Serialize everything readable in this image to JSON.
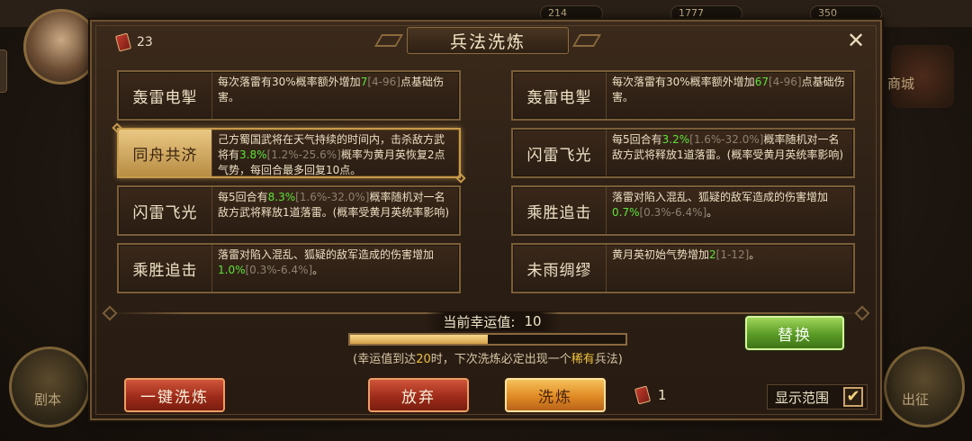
{
  "background": {
    "resources": [
      "214",
      "1777",
      "350"
    ],
    "left_button_label": "剧本",
    "right_button_label": "出征",
    "right_top_label": "商城"
  },
  "dialog": {
    "title": "兵法洗炼",
    "scroll_count": "23",
    "close_icon": "close-icon"
  },
  "current_skills": [
    {
      "name": "轰雷电掣",
      "selected": false,
      "desc_parts": [
        {
          "t": "每次落雷有30%概率额外增加"
        },
        {
          "t": "7",
          "c": "g"
        },
        {
          "t": "[4-96]",
          "c": "r"
        },
        {
          "t": "点基础伤害。"
        }
      ]
    },
    {
      "name": "同舟共济",
      "selected": true,
      "desc_parts": [
        {
          "t": "己方蜀国武将在天气持续的时间内，击杀敌方武将有"
        },
        {
          "t": "3.8%",
          "c": "g"
        },
        {
          "t": "[1.2%-25.6%]",
          "c": "r"
        },
        {
          "t": "概率为黄月英恢复2点气势，每回合最多回复10点。"
        }
      ]
    },
    {
      "name": "闪雷飞光",
      "selected": false,
      "desc_parts": [
        {
          "t": "每5回合有"
        },
        {
          "t": "8.3%",
          "c": "g"
        },
        {
          "t": "[1.6%-32.0%]",
          "c": "r"
        },
        {
          "t": "概率随机对一名敌方武将释放1道落雷。(概率受黄月英统率影响)"
        }
      ]
    },
    {
      "name": "乘胜追击",
      "selected": false,
      "desc_parts": [
        {
          "t": "落雷对陷入混乱、狐疑的敌军造成的伤害增加"
        },
        {
          "t": "1.0%",
          "c": "g"
        },
        {
          "t": "[0.3%-6.4%]",
          "c": "r"
        },
        {
          "t": "。"
        }
      ]
    }
  ],
  "new_skills": [
    {
      "name": "轰雷电掣",
      "upgrade": true,
      "desc_parts": [
        {
          "t": "每次落雷有30%概率额外增加"
        },
        {
          "t": "67",
          "c": "g"
        },
        {
          "t": "[4-96]",
          "c": "r"
        },
        {
          "t": "点基础伤害。"
        }
      ]
    },
    {
      "name": "闪雷飞光",
      "upgrade": false,
      "desc_parts": [
        {
          "t": "每5回合有"
        },
        {
          "t": "3.2%",
          "c": "g"
        },
        {
          "t": "[1.6%-32.0%]",
          "c": "r"
        },
        {
          "t": "概率随机对一名敌方武将释放1道落雷。(概率受黄月英统率影响)"
        }
      ]
    },
    {
      "name": "乘胜追击",
      "upgrade": false,
      "desc_parts": [
        {
          "t": "落雷对陷入混乱、狐疑的敌军造成的伤害增加"
        },
        {
          "t": "0.7%",
          "c": "g"
        },
        {
          "t": "[0.3%-6.4%]",
          "c": "r"
        },
        {
          "t": "。"
        }
      ]
    },
    {
      "name": "未雨绸缪",
      "upgrade": false,
      "desc_parts": [
        {
          "t": "黄月英初始气势增加"
        },
        {
          "t": "2",
          "c": "g"
        },
        {
          "t": "[1-12]",
          "c": "r"
        },
        {
          "t": "。"
        }
      ]
    }
  ],
  "luck": {
    "label": "当前幸运值:",
    "value": "10",
    "progress": 0.5,
    "note_prefix": "(幸运值到达",
    "note_threshold": "20",
    "note_mid": "时，下次洗炼必定出现一个",
    "note_rare": "稀有",
    "note_suffix": "兵法)"
  },
  "buttons": {
    "one_click": "一键洗炼",
    "give_up": "放弃",
    "refine": "洗炼",
    "replace": "替换"
  },
  "cost": {
    "amount": "1"
  },
  "range_toggle": {
    "label": "显示范围",
    "checked": true,
    "check_glyph": "✔"
  },
  "colors": {
    "highlight_green": "#5fe33a",
    "range_gray": "#8d8170",
    "luck_yellow": "#f0c23a"
  }
}
